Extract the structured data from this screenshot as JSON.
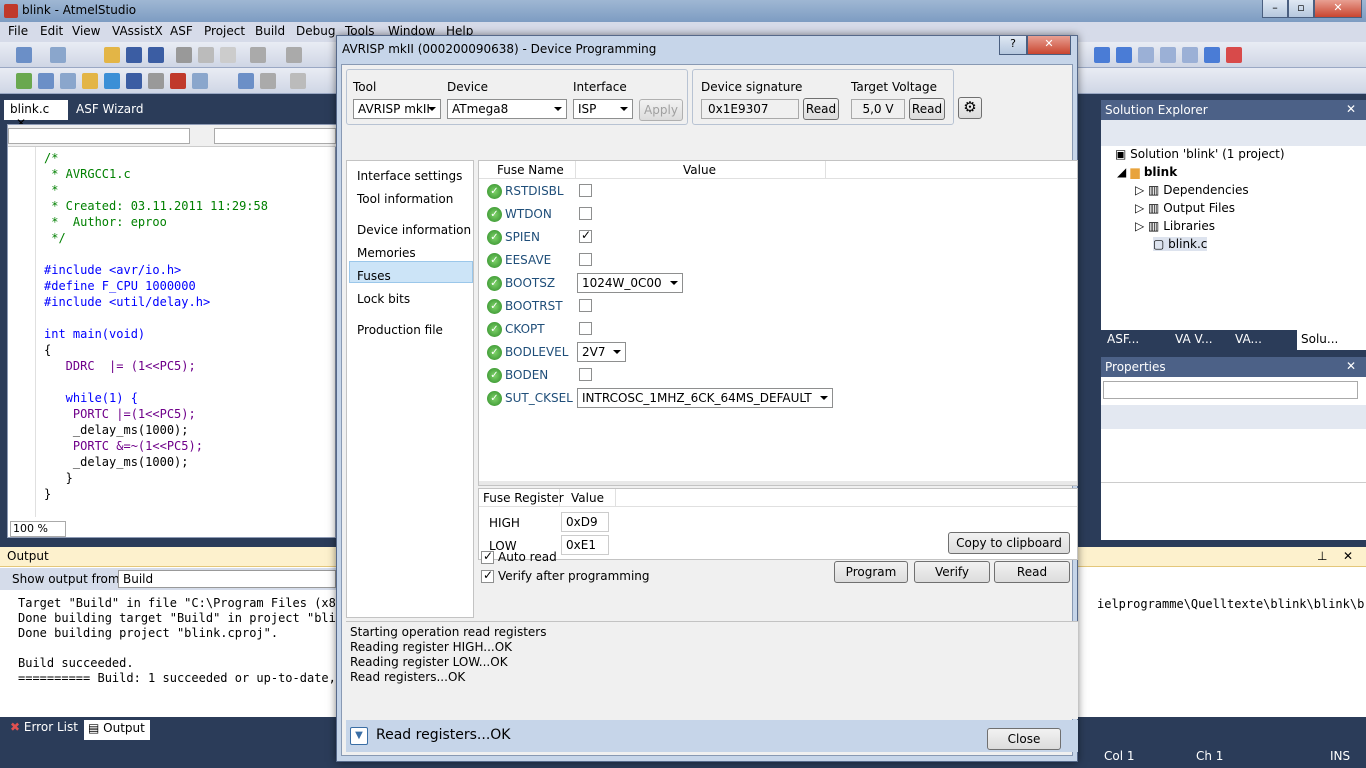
{
  "window": {
    "title": "blink - AtmelStudio"
  },
  "menu": [
    "File",
    "Edit",
    "View",
    "VAssistX",
    "ASF",
    "Project",
    "Build",
    "Debug",
    "Tools",
    "Window",
    "Help"
  ],
  "doc_tabs": [
    "blink.c",
    "ASF Wizard"
  ],
  "editor": {
    "lines": [
      "/*",
      " * AVRGCC1.c",
      " *",
      " * Created: 03.11.2011 11:29:58",
      " *  Author: eproo",
      " */",
      "",
      "#include <avr/io.h>",
      "#define F_CPU 1000000",
      "#include <util/delay.h>",
      "",
      "int main(void)",
      "{",
      "   DDRC  |= (1<<PC5);",
      "",
      "   while(1) {",
      "    PORTC |=(1<<PC5);",
      "    _delay_ms(1000);",
      "    PORTC &=~(1<<PC5);",
      "    _delay_ms(1000);",
      "   }",
      "}"
    ],
    "zoom": "100 %"
  },
  "output": {
    "title": "Output",
    "show_from_label": "Show output from:",
    "source": "Build",
    "lines": [
      "Target \"Build\" in file \"C:\\Program Files (x86",
      "Done building target \"Build\" in project \"blin",
      "Done building project \"blink.cproj\".",
      "",
      "Build succeeded.",
      "========== Build: 1 succeeded or up-to-date,"
    ],
    "right_text": "ielprogramme\\Quelltexte\\blink\\blink\\b"
  },
  "bottom_tabs": [
    "Error List",
    "Output"
  ],
  "status": {
    "col": "Col 1",
    "ch": "Ch 1",
    "ins": "INS"
  },
  "solution_explorer": {
    "title": "Solution Explorer",
    "items": [
      "Solution 'blink' (1 project)",
      "blink",
      "Dependencies",
      "Output Files",
      "Libraries",
      "blink.c"
    ],
    "tabs": [
      "ASF...",
      "VA V...",
      "VA...",
      "Solu..."
    ]
  },
  "properties": {
    "title": "Properties"
  },
  "dialog": {
    "title": "AVRISP mkII (000200090638) - Device Programming",
    "help": "?",
    "tool_label": "Tool",
    "tool": "AVRISP mkII",
    "device_label": "Device",
    "device": "ATmega8",
    "interface_label": "Interface",
    "interface": "ISP",
    "apply": "Apply",
    "signature_label": "Device signature",
    "signature": "0x1E9307",
    "read": "Read",
    "voltage_label": "Target Voltage",
    "voltage": "5,0 V",
    "nav": [
      "Interface settings",
      "Tool information",
      "Device information",
      "Memories",
      "Fuses",
      "Lock bits",
      "Production file"
    ],
    "nav_selected": "Fuses",
    "fuse_headers": [
      "Fuse Name",
      "Value"
    ],
    "fuses": [
      {
        "name": "RSTDISBL",
        "type": "check",
        "checked": false
      },
      {
        "name": "WTDON",
        "type": "check",
        "checked": false
      },
      {
        "name": "SPIEN",
        "type": "check",
        "checked": true
      },
      {
        "name": "EESAVE",
        "type": "check",
        "checked": false
      },
      {
        "name": "BOOTSZ",
        "type": "combo",
        "value": "1024W_0C00"
      },
      {
        "name": "BOOTRST",
        "type": "check",
        "checked": false
      },
      {
        "name": "CKOPT",
        "type": "check",
        "checked": false
      },
      {
        "name": "BODLEVEL",
        "type": "combo",
        "value": "2V7"
      },
      {
        "name": "BODEN",
        "type": "check",
        "checked": false
      },
      {
        "name": "SUT_CKSEL",
        "type": "combo",
        "value": "INTRCOSC_1MHZ_6CK_64MS_DEFAULT"
      }
    ],
    "reg_headers": [
      "Fuse Register",
      "Value"
    ],
    "registers": [
      {
        "name": "HIGH",
        "value": "0xD9"
      },
      {
        "name": "LOW",
        "value": "0xE1"
      }
    ],
    "copy": "Copy to clipboard",
    "auto_read": "Auto read",
    "verify_after": "Verify after programming",
    "program": "Program",
    "verify": "Verify",
    "log": [
      "Starting operation read registers",
      "Reading register HIGH...OK",
      "Reading register LOW...OK",
      "Read registers...OK"
    ],
    "status": "Read registers...OK",
    "close": "Close"
  }
}
